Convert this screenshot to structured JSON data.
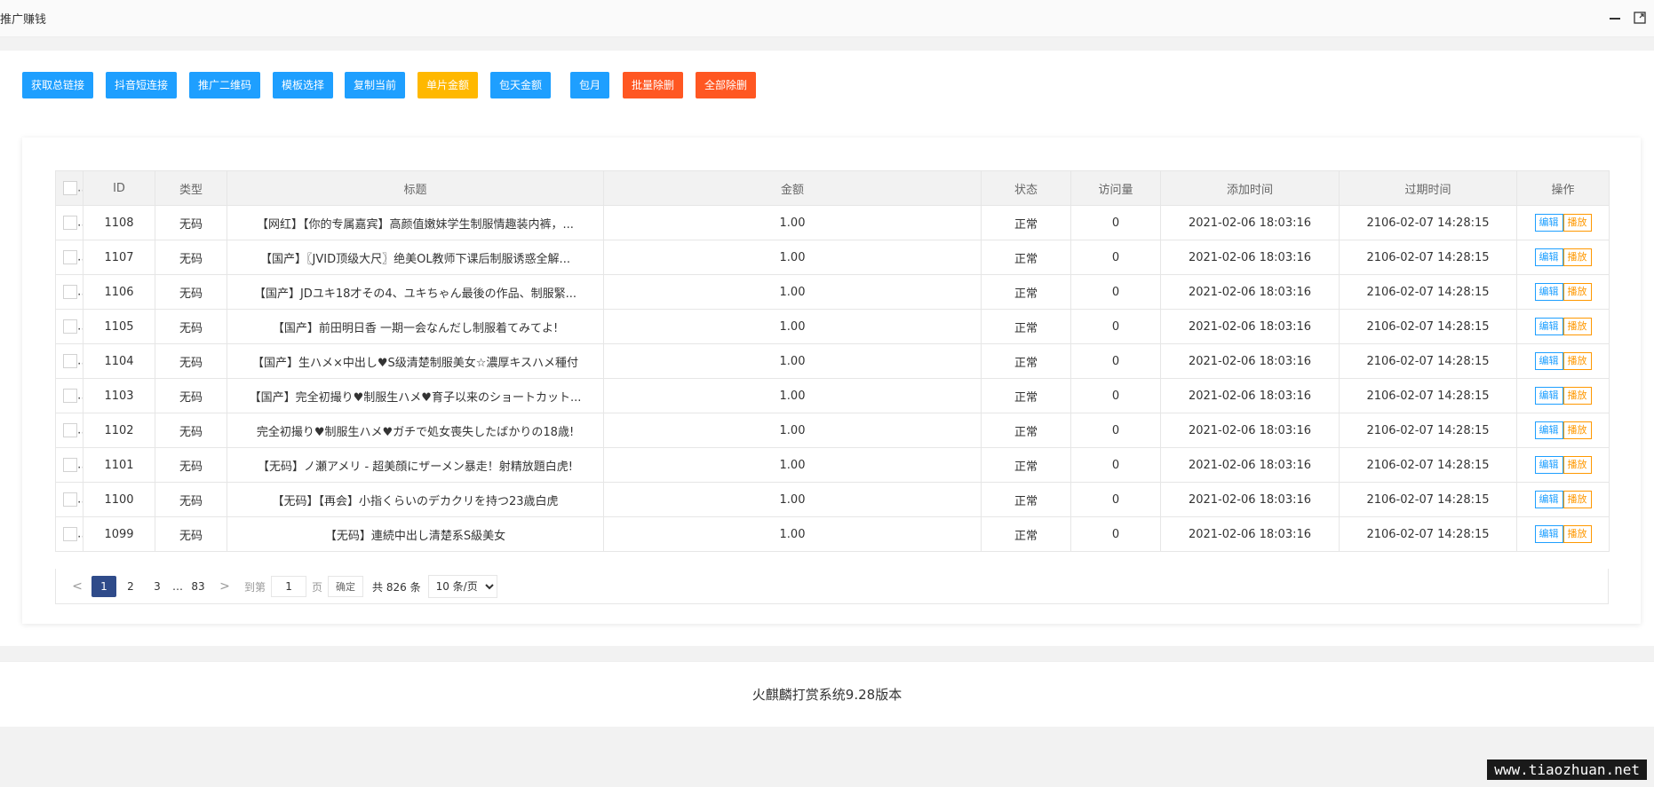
{
  "window": {
    "title": "推广赚钱"
  },
  "toolbar": {
    "buttons": [
      {
        "label": "获取总链接",
        "color": "#1e9fff"
      },
      {
        "label": "抖音短连接",
        "color": "#1e9fff"
      },
      {
        "label": "推广二维码",
        "color": "#1e9fff"
      },
      {
        "label": "模板选择",
        "color": "#1e9fff"
      },
      {
        "label": "复制当前",
        "color": "#1e9fff"
      },
      {
        "label": "单片金额",
        "color": "#ffb800"
      },
      {
        "label": "包天金额",
        "color": "#1e9fff"
      },
      {
        "label": "包月",
        "color": "#1e9fff"
      },
      {
        "label": "批量除删",
        "color": "#ff5722"
      },
      {
        "label": "全部除删",
        "color": "#ff5722"
      }
    ]
  },
  "table": {
    "columns": [
      "ID",
      "类型",
      "标题",
      "金额",
      "状态",
      "访问量",
      "添加时间",
      "过期时间",
      "操作"
    ],
    "edit_label": "编辑",
    "play_label": "播放",
    "rows": [
      {
        "id": "1108",
        "type": "无码",
        "title": "【网红】【你的专属嘉宾】高颜值嫩妹学生制服情趣装内裤，...",
        "amount": "1.00",
        "status": "正常",
        "visits": "0",
        "added": "2021-02-06 18:03:16",
        "expires": "2106-02-07 14:28:15"
      },
      {
        "id": "1107",
        "type": "无码",
        "title": "【国产】〖JVID顶级大尺〗绝美OL教师下课后制服诱惑全解...",
        "amount": "1.00",
        "status": "正常",
        "visits": "0",
        "added": "2021-02-06 18:03:16",
        "expires": "2106-02-07 14:28:15"
      },
      {
        "id": "1106",
        "type": "无码",
        "title": "【国产】JDユキ18才その4、ユキちゃん最後の作品、制服緊...",
        "amount": "1.00",
        "status": "正常",
        "visits": "0",
        "added": "2021-02-06 18:03:16",
        "expires": "2106-02-07 14:28:15"
      },
      {
        "id": "1105",
        "type": "无码",
        "title": "【国产】前田明日香 一期一会なんだし制服着てみてよ!",
        "amount": "1.00",
        "status": "正常",
        "visits": "0",
        "added": "2021-02-06 18:03:16",
        "expires": "2106-02-07 14:28:15"
      },
      {
        "id": "1104",
        "type": "无码",
        "title": "【国产】生ハメ×中出し♥S级清楚制服美女☆濃厚キスハメ種付",
        "amount": "1.00",
        "status": "正常",
        "visits": "0",
        "added": "2021-02-06 18:03:16",
        "expires": "2106-02-07 14:28:15"
      },
      {
        "id": "1103",
        "type": "无码",
        "title": "【国产】完全初撮り♥制服生ハメ♥育子以来のショートカット...",
        "amount": "1.00",
        "status": "正常",
        "visits": "0",
        "added": "2021-02-06 18:03:16",
        "expires": "2106-02-07 14:28:15"
      },
      {
        "id": "1102",
        "type": "无码",
        "title": "完全初撮り♥制服生ハメ♥ガチで処女喪失したばかりの18歳!",
        "amount": "1.00",
        "status": "正常",
        "visits": "0",
        "added": "2021-02-06 18:03:16",
        "expires": "2106-02-07 14:28:15"
      },
      {
        "id": "1101",
        "type": "无码",
        "title": "【无码】ノ瀬アメリ - 超美顔にザーメン暴走！射精放題白虎!",
        "amount": "1.00",
        "status": "正常",
        "visits": "0",
        "added": "2021-02-06 18:03:16",
        "expires": "2106-02-07 14:28:15"
      },
      {
        "id": "1100",
        "type": "无码",
        "title": "【无码】【再会】小指くらいのデカクリを持つ23歳白虎",
        "amount": "1.00",
        "status": "正常",
        "visits": "0",
        "added": "2021-02-06 18:03:16",
        "expires": "2106-02-07 14:28:15"
      },
      {
        "id": "1099",
        "type": "无码",
        "title": "【无码】連続中出し清楚系S級美女",
        "amount": "1.00",
        "status": "正常",
        "visits": "0",
        "added": "2021-02-06 18:03:16",
        "expires": "2106-02-07 14:28:15"
      }
    ]
  },
  "pagination": {
    "prev": "<",
    "pages": [
      "1",
      "2",
      "3"
    ],
    "current": "1",
    "ellipsis": "…",
    "last": "83",
    "next": ">",
    "goto_label": "到第",
    "goto_value": "1",
    "page_label": "页",
    "confirm_label": "确定",
    "total_label": "共 826 条",
    "page_size": "10 条/页"
  },
  "footer": {
    "version": "火麒麟打赏系统9.28版本"
  },
  "watermark": "www.tiaozhuan.net",
  "colors": {
    "accent": "#1e9fff",
    "warn": "#ffb800",
    "danger": "#ff5722",
    "ok": "#5fb878",
    "page_active": "#2f4b8a"
  }
}
